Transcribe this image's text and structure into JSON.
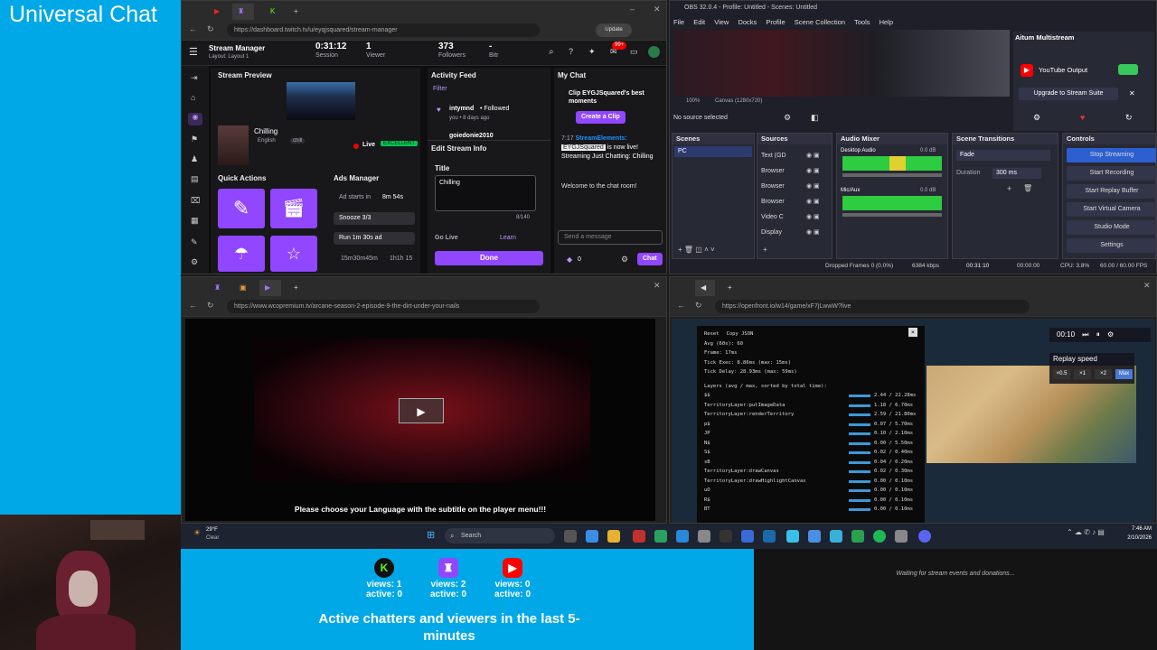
{
  "overlay": {
    "title": "Universal Chat",
    "platforms": [
      {
        "name": "kick-icon",
        "views": "views: 1",
        "active": "active: 0",
        "color": "#53fc18"
      },
      {
        "name": "twitch-icon",
        "views": "views: 2",
        "active": "active: 0",
        "color": "#9146ff"
      },
      {
        "name": "youtube-icon",
        "views": "views: 0",
        "active": "active: 0",
        "color": "#ff0000"
      }
    ],
    "stats_caption": "Active chatters and viewers in the last 5-minutes",
    "donation_text": "Waiting for stream events and donations..."
  },
  "twitch": {
    "tab_url": "https://dashboard.twitch.tv/u/eyqjsquared/stream-manager",
    "header": {
      "title": "Stream Manager",
      "layout": "Layout: Layout 1",
      "session_time": "0:31:12",
      "session_label": "Session",
      "viewers_count": "1",
      "viewers_label": "Viewer",
      "followers_count": "373",
      "followers_label": "Followers",
      "bitrate_value": "-",
      "bitrate_label": "Bitr",
      "badge": "99+"
    },
    "preview": {
      "title": "Stream Preview",
      "stream_title": "Chilling",
      "language": "English",
      "tag": "chill",
      "live_label": "Live",
      "health": "EXCELLENT"
    },
    "quick_actions": {
      "title": "Quick Actions"
    },
    "ads": {
      "title": "Ads Manager",
      "starts_in_label": "Ad starts in",
      "starts_in_value": "8m 54s",
      "snooze": "Snooze 3/3",
      "run": "Run 1m 30s ad",
      "time1": "15m30m45m",
      "time2": "1h1h 15"
    },
    "activity": {
      "title": "Activity Feed",
      "filter": "Filter",
      "item1_name": "intymnd",
      "item1_action": "• Followed",
      "item1_time": "you • 8 days ago",
      "item2_name": "goiedonie2010"
    },
    "edit": {
      "title": "Edit Stream Info",
      "field_label": "Title",
      "field_value": "Chilling",
      "counter": "8/140",
      "golive_label": "Go Live",
      "learn": "Learn",
      "done": "Done"
    },
    "chat": {
      "title": "My Chat",
      "clip_text": "Clip EYGJSquared's best moments",
      "create_clip": "Create a Clip",
      "msg_time": "7:17",
      "msg_user": "StreamElements:",
      "msg_mention": "EYGJSquared",
      "msg_text": "is now live! Streaming Just Chatting: Chilling",
      "welcome": "Welcome to the chat room!",
      "input_placeholder": "Send a message",
      "points": "0",
      "send": "Chat"
    }
  },
  "obs": {
    "title": "OBS 32.0.4 - Profile: Untitled - Scenes: Untitled",
    "menu": [
      "File",
      "Edit",
      "View",
      "Docks",
      "Profile",
      "Scene Collection",
      "Tools",
      "Help"
    ],
    "canvas_label": "Canvas (1280x720)",
    "zoom": "100%",
    "no_source": "No source selected",
    "multistream": {
      "title": "Aitum Multistream",
      "youtube": "YouTube Output",
      "upgrade": "Upgrade to Stream Suite"
    },
    "scenes": {
      "title": "Scenes",
      "items": [
        "PC"
      ]
    },
    "sources": {
      "title": "Sources",
      "items": [
        "Text (GD",
        "Browser",
        "Browser",
        "Browser",
        "Video C",
        "Display"
      ]
    },
    "mixer": {
      "title": "Audio Mixer",
      "ch1_name": "Desktop Audio",
      "ch1_db": "0.0 dB",
      "ch2_name": "Mic/Aux",
      "ch2_db": "0.0 dB"
    },
    "transitions": {
      "title": "Scene Transitions",
      "type": "Fade",
      "duration_label": "Duration",
      "duration_value": "300 ms"
    },
    "controls": {
      "title": "Controls",
      "buttons": [
        "Stop Streaming",
        "Start Recording",
        "Start Replay Buffer",
        "Start Virtual Camera",
        "Studio Mode",
        "Settings"
      ]
    },
    "status": {
      "dropped": "Dropped Frames 0 (0.0%)",
      "kbps": "6384 kbps",
      "stream_time": "00:31:10",
      "rec_time": "00:00:00",
      "cpu": "CPU: 3.8%",
      "fps": "60.00 / 60.00 FPS"
    }
  },
  "weco": {
    "url": "https://www.wcopremium.tv/arcane-season-2-episode-9-the-dirt-under-your-nails",
    "subtitle_notice": "Please choose your Language with the subtitle on the player menu!!!"
  },
  "openfront": {
    "url": "https://openfront.io/w14/game/xF7jLwwW?live",
    "time": "00:10",
    "replay_speed_label": "Replay speed",
    "speeds": [
      "×0.5",
      "×1",
      "×2",
      "Max"
    ],
    "debug": {
      "reset": "Reset",
      "copy": "Copy JSON",
      "avg": "Avg (60s): 60",
      "frame": "Frame: 17ms",
      "tick_exec": "Tick Exec: 8.86ms (max: 15ms)",
      "tick_delay": "Tick Delay: 28.93ms (max: 59ms)",
      "layers_header": "Layers (avg / max, sorted by total time):",
      "layers": [
        {
          "name": "$$",
          "val": "2.44 / 22.28ms"
        },
        {
          "name": "TerritoryLayer:putImageData",
          "val": "1.18 / 6.70ms"
        },
        {
          "name": "TerritoryLayer:renderTerritory",
          "val": "2.59 / 21.80ms"
        },
        {
          "name": "p$",
          "val": "0.07 / 5.70ms"
        },
        {
          "name": "JP",
          "val": "0.10 / 2.10ms"
        },
        {
          "name": "N$",
          "val": "0.00 / 5.50ms"
        },
        {
          "name": "S$",
          "val": "0.02 / 0.40ms"
        },
        {
          "name": "sB",
          "val": "0.04 / 0.20ms"
        },
        {
          "name": "TerritoryLayer:drawCanvas",
          "val": "0.02 / 0.30ms"
        },
        {
          "name": "TerritoryLayer:drawHighlightCanvas",
          "val": "0.00 / 0.10ms"
        },
        {
          "name": "uO",
          "val": "0.00 / 0.10ms"
        },
        {
          "name": "R$",
          "val": "0.00 / 0.10ms"
        },
        {
          "name": "BT",
          "val": "0.00 / 0.10ms"
        }
      ]
    }
  },
  "taskbar": {
    "weather_temp": "29°F",
    "weather_desc": "Clear",
    "search_placeholder": "Search",
    "time": "7:46 AM",
    "date": "2/10/2026"
  }
}
